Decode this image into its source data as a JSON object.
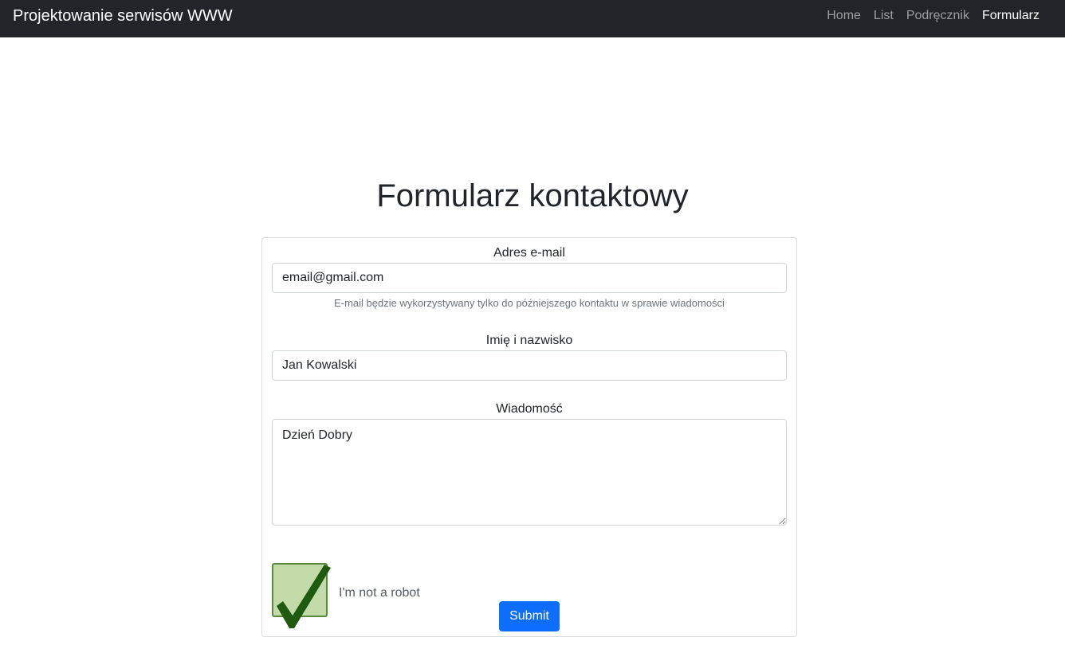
{
  "navbar": {
    "brand": "Projektowanie serwisów WWW",
    "links": [
      {
        "label": "Home",
        "active": false
      },
      {
        "label": "List",
        "active": false
      },
      {
        "label": "Podręcznik",
        "active": false
      },
      {
        "label": "Formularz",
        "active": true
      }
    ]
  },
  "page": {
    "title": "Formularz kontaktowy"
  },
  "form": {
    "email": {
      "label": "Adres e-mail",
      "value": "email@gmail.com",
      "help": "E-mail będzie wykorzystywany tylko do późniejszego kontaktu w sprawie wiadomości"
    },
    "name": {
      "label": "Imię i nazwisko",
      "value": "Jan Kowalski"
    },
    "message": {
      "label": "Wiadomość",
      "value": "Dzień Dobry"
    },
    "captcha": {
      "label": "I'm not a robot",
      "checked": true,
      "icon": "checkmark-icon"
    },
    "submit_label": "Submit"
  },
  "colors": {
    "navbar_bg": "#212529",
    "primary": "#0d6efd",
    "captcha_fill": "#c3dba8",
    "check_color": "#1e5a10"
  }
}
